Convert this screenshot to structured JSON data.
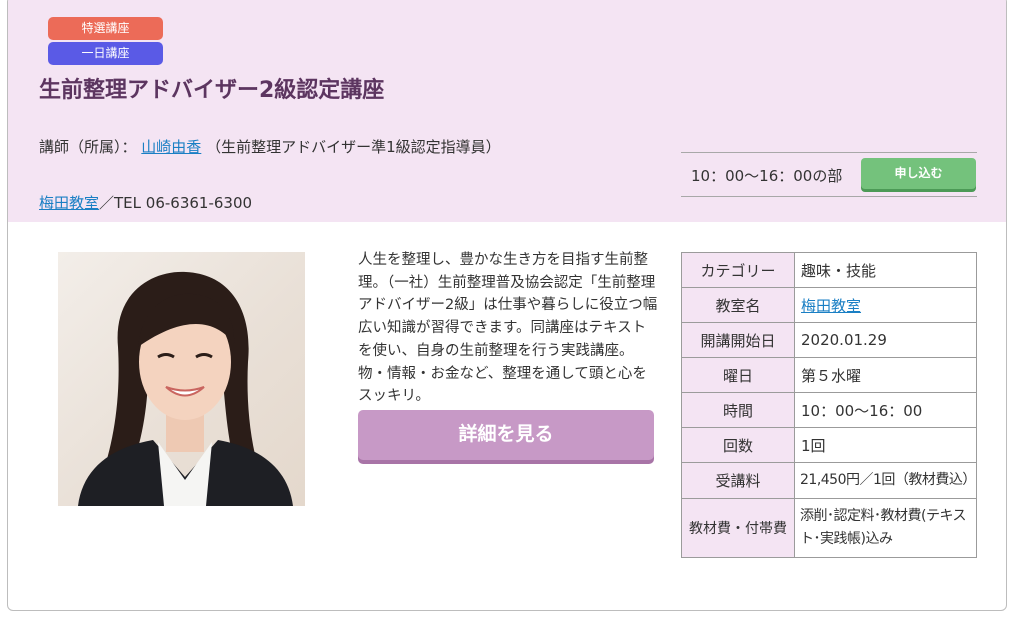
{
  "badges": {
    "special": "特選講座",
    "oneday": "一日講座"
  },
  "course": {
    "title": "生前整理アドバイザー2級認定講座",
    "instructor_label": "講師（所属）：",
    "instructor_name": "山崎由香",
    "instructor_affiliation": "（生前整理アドバイザー準1級認定指導員）",
    "classroom_name": "梅田教室",
    "classroom_tel": "／TEL 06-6361-6300"
  },
  "session": {
    "time": "10：00〜16：00の部",
    "apply_label": "申し込む"
  },
  "description": "人生を整理し、豊かな生き方を目指す生前整理。（一社）生前整理普及協会認定「生前整理アドバイザー2級」は仕事や暮らしに役立つ幅広い知識が習得できます。同講座はテキストを使い、自身の生前整理を行う実践講座。物・情報・お金など、整理を通して頭と心をスッキリ。",
  "detail_button": "詳細を見る",
  "info": {
    "category": {
      "label": "カテゴリー",
      "value": "趣味・技能"
    },
    "classroom": {
      "label": "教室名",
      "value": "梅田教室"
    },
    "start_date": {
      "label": "開講開始日",
      "value": "2020.01.29"
    },
    "weekday": {
      "label": "曜日",
      "value": "第５水曜"
    },
    "time": {
      "label": "時間",
      "value": "10：00〜16：00"
    },
    "count": {
      "label": "回数",
      "value": "1回"
    },
    "fee": {
      "label": "受講料",
      "value": "21,450円／1回（教材費込）"
    },
    "materials": {
      "label": "教材費・付帯費",
      "value": "添削･認定料･教材費(テキスト･実践帳)込み"
    }
  },
  "colors": {
    "header_bg": "#f4e4f3",
    "badge_special": "#ec6b58",
    "badge_oneday": "#5a5ae6",
    "apply_button": "#74c27c",
    "detail_button": "#c799c6",
    "title": "#5c3560",
    "link": "#1a7fc4"
  }
}
